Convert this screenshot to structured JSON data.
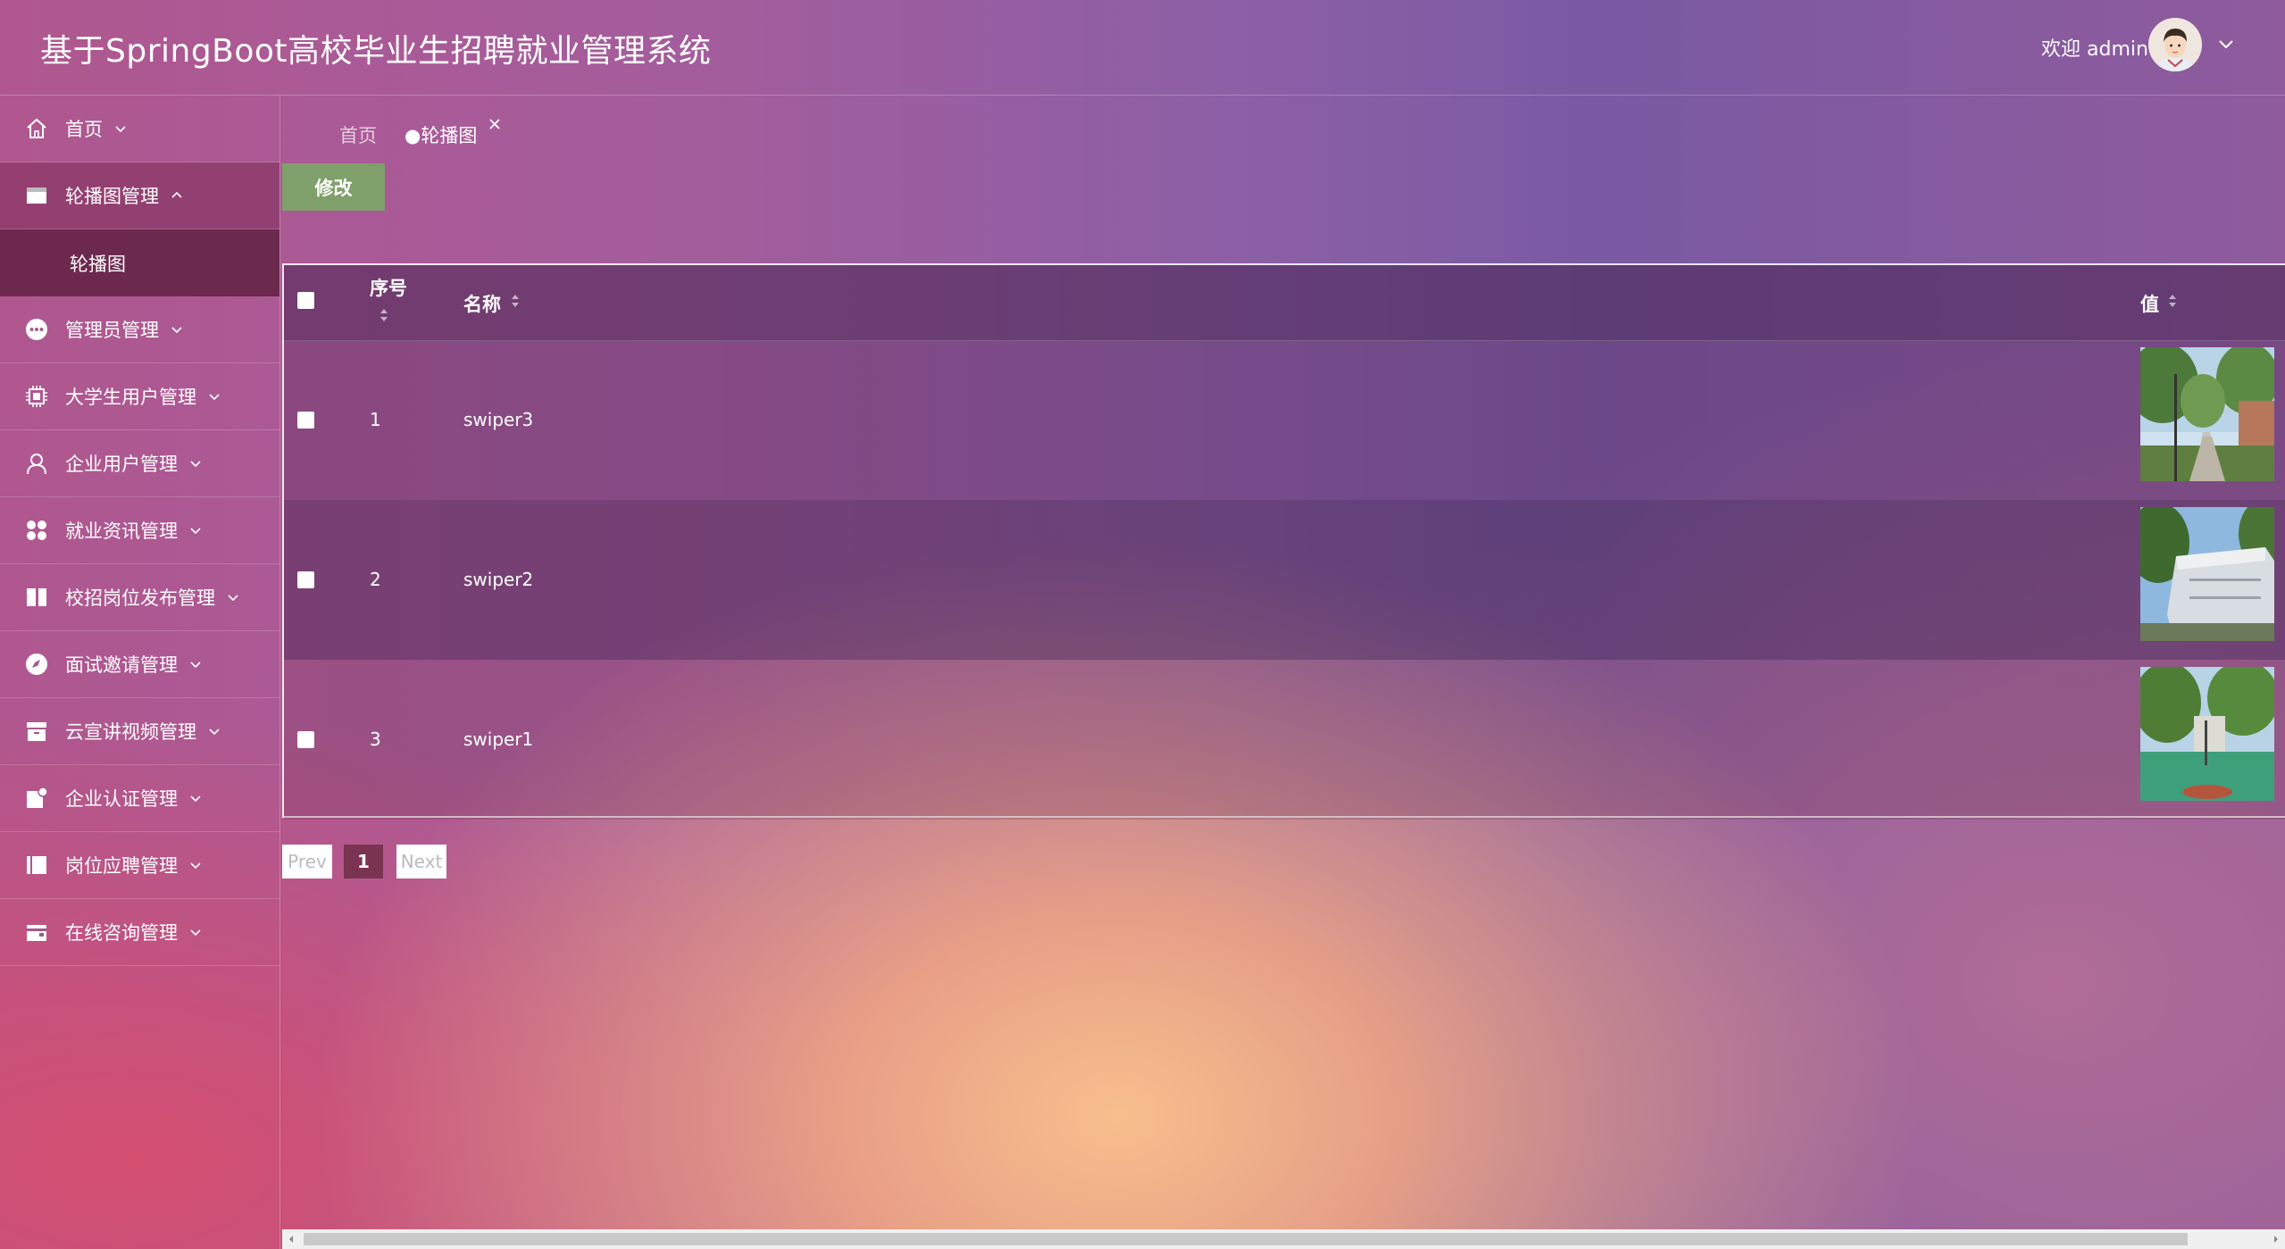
{
  "header": {
    "title": "基于SpringBoot高校毕业生招聘就业管理系统",
    "welcome": "欢迎 admin"
  },
  "sidebar": {
    "items": [
      {
        "label": "首页",
        "icon": "home-icon"
      },
      {
        "label": "轮播图管理",
        "icon": "card-icon",
        "expanded": true
      },
      {
        "label": "管理员管理",
        "icon": "more-dots-icon"
      },
      {
        "label": "大学生用户管理",
        "icon": "chip-icon"
      },
      {
        "label": "企业用户管理",
        "icon": "person-icon"
      },
      {
        "label": "就业资讯管理",
        "icon": "grid-icon"
      },
      {
        "label": "校招岗位发布管理",
        "icon": "columns-icon"
      },
      {
        "label": "面试邀请管理",
        "icon": "compass-icon"
      },
      {
        "label": "云宣讲视频管理",
        "icon": "archive-icon"
      },
      {
        "label": "企业认证管理",
        "icon": "note-icon"
      },
      {
        "label": "岗位应聘管理",
        "icon": "book-icon"
      },
      {
        "label": "在线咨询管理",
        "icon": "wallet-icon"
      }
    ],
    "submenu": {
      "label": "轮播图"
    }
  },
  "tabs": {
    "home": "首页",
    "current": "●轮播图"
  },
  "toolbar": {
    "edit_label": "修改"
  },
  "table": {
    "headers": {
      "index": "序号",
      "name": "名称",
      "value": "值"
    },
    "rows": [
      {
        "index": "1",
        "name": "swiper3"
      },
      {
        "index": "2",
        "name": "swiper2"
      },
      {
        "index": "3",
        "name": "swiper1"
      }
    ]
  },
  "pagination": {
    "prev": "Prev",
    "current": "1",
    "next": "Next"
  },
  "colors": {
    "accent": "#7a3350",
    "edit_button": "#7fa06b"
  }
}
